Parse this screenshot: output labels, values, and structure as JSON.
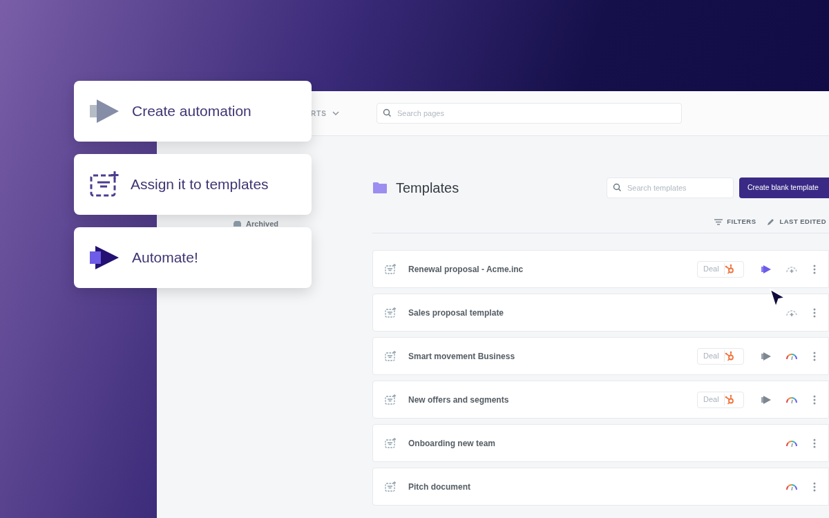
{
  "top_bar": {
    "nav_label": "RTS",
    "search_placeholder": "Search pages"
  },
  "sidebar": {
    "items": [
      {
        "label": "Archived"
      }
    ]
  },
  "header": {
    "title": "Templates",
    "search_placeholder": "Search templates",
    "create_button": "Create blank template"
  },
  "toolbar": [
    {
      "label": "FILTERS",
      "kind": "filter"
    },
    {
      "label": "LAST EDITED",
      "kind": "edit"
    }
  ],
  "templates": [
    {
      "name": "Renewal proposal - Acme.inc",
      "tag": "Deal",
      "automated": true,
      "automation_active": true,
      "scored": false
    },
    {
      "name": "Sales proposal template",
      "automated": false,
      "scored": false
    },
    {
      "name": "Smart movement Business",
      "tag": "Deal",
      "automated": true,
      "automation_active": false,
      "scored": true
    },
    {
      "name": "New offers and segments",
      "tag": "Deal",
      "automated": true,
      "automation_active": false,
      "scored": true
    },
    {
      "name": "Onboarding new team",
      "automated": false,
      "scored": true
    },
    {
      "name": "Pitch document",
      "automated": false,
      "scored": true
    }
  ],
  "steps": [
    {
      "label": "Create automation",
      "kind": "create"
    },
    {
      "label": "Assign it to templates",
      "kind": "assign"
    },
    {
      "label": "Automate!",
      "kind": "automate"
    }
  ]
}
